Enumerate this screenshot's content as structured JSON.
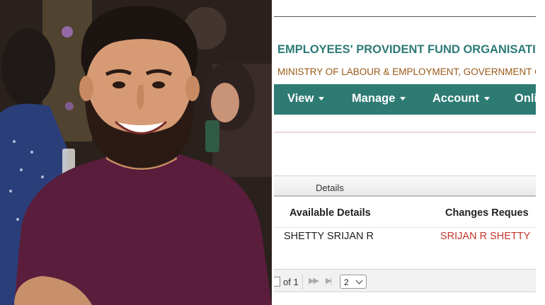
{
  "header": {
    "org_title": "EMPLOYEES' PROVIDENT FUND ORGANISATION,",
    "ministry": "MINISTRY OF LABOUR & EMPLOYMENT, GOVERNMENT OI"
  },
  "nav": {
    "items": [
      {
        "label": "View"
      },
      {
        "label": "Manage"
      },
      {
        "label": "Account"
      },
      {
        "label": "Onlin"
      }
    ]
  },
  "table": {
    "tab_label": "Details",
    "columns": [
      "Available Details",
      "Changes Reques"
    ],
    "rows": [
      {
        "available": "SHETTY SRIJAN R",
        "change": "SRIJAN R SHETTY"
      }
    ]
  },
  "pager": {
    "of_text": "of 1",
    "page_size": "2"
  },
  "colors": {
    "teal": "#2e7b74",
    "title_teal": "#2d7a78",
    "ministry_brown": "#9a5a17",
    "change_red": "#c4362c"
  }
}
